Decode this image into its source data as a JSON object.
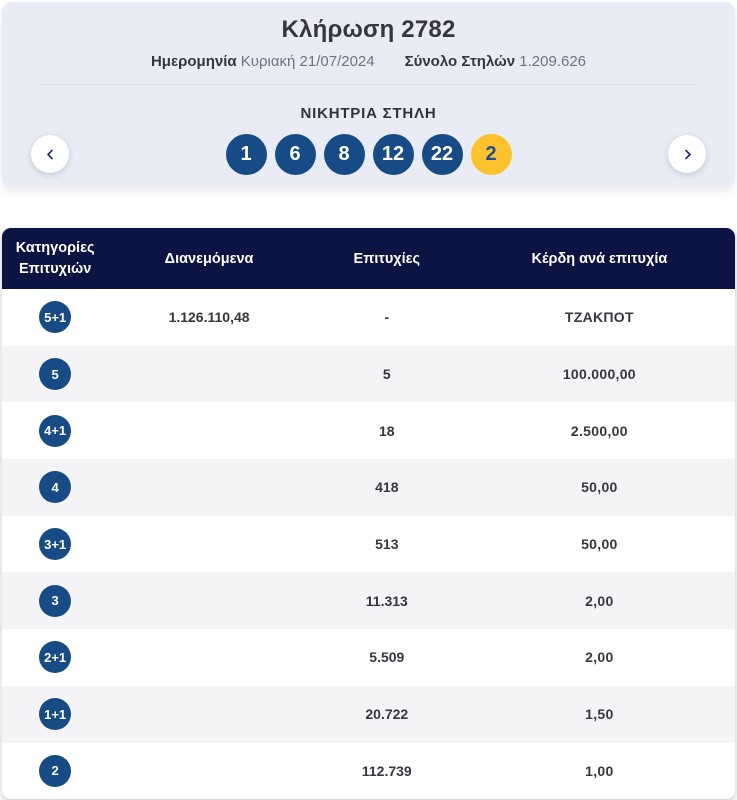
{
  "header": {
    "title": "Κλήρωση 2782",
    "date_label": "Ημερομηνία",
    "date_value": "Κυριακή 21/07/2024",
    "columns_label": "Σύνολο Στηλών",
    "columns_value": "1.209.626"
  },
  "winning": {
    "title": "ΝΙΚΗΤΡΙΑ ΣΤΗΛΗ",
    "numbers": [
      "1",
      "6",
      "8",
      "12",
      "22"
    ],
    "bonus": "2"
  },
  "table": {
    "headers": {
      "category": "Κατηγορίες Επιτυχιών",
      "distributed": "Διανεμόμενα",
      "winners": "Επιτυχίες",
      "prize": "Κέρδη ανά επιτυχία"
    },
    "rows": [
      {
        "category": "5+1",
        "distributed": "1.126.110,48",
        "winners": "-",
        "prize": "ΤΖΑΚΠΟΤ"
      },
      {
        "category": "5",
        "distributed": "",
        "winners": "5",
        "prize": "100.000,00"
      },
      {
        "category": "4+1",
        "distributed": "",
        "winners": "18",
        "prize": "2.500,00"
      },
      {
        "category": "4",
        "distributed": "",
        "winners": "418",
        "prize": "50,00"
      },
      {
        "category": "3+1",
        "distributed": "",
        "winners": "513",
        "prize": "50,00"
      },
      {
        "category": "3",
        "distributed": "",
        "winners": "11.313",
        "prize": "2,00"
      },
      {
        "category": "2+1",
        "distributed": "",
        "winners": "5.509",
        "prize": "2,00"
      },
      {
        "category": "1+1",
        "distributed": "",
        "winners": "20.722",
        "prize": "1,50"
      },
      {
        "category": "2",
        "distributed": "",
        "winners": "112.739",
        "prize": "1,00"
      }
    ]
  },
  "colors": {
    "number_ball_blue": "#174B86",
    "bonus_ball_yellow": "#FDC32C",
    "table_header_navy": "#0B1442",
    "panel_background": "#EAECF5",
    "alt_row_background": "#F4F4F6"
  }
}
